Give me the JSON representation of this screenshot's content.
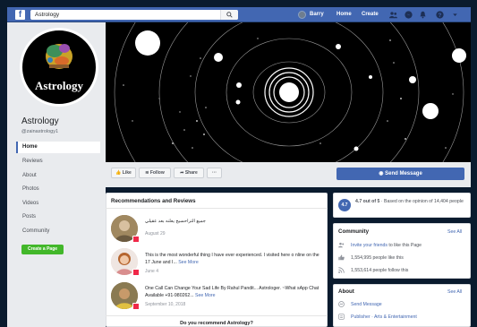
{
  "topbar": {
    "logo": "f",
    "search_value": "Astrology",
    "user_name": "Barry",
    "home": "Home",
    "create": "Create"
  },
  "sidebar": {
    "avatar_word": "Astrology",
    "page_name": "Astrology",
    "handle": "@zainastrology1",
    "items": [
      {
        "label": "Home"
      },
      {
        "label": "Reviews"
      },
      {
        "label": "About"
      },
      {
        "label": "Photos"
      },
      {
        "label": "Videos"
      },
      {
        "label": "Posts"
      },
      {
        "label": "Community"
      }
    ],
    "create_page": "Create a Page"
  },
  "actions": {
    "like": "Like",
    "follow": "Follow",
    "share": "Share",
    "more": "···",
    "send_message": "Send Message"
  },
  "recommendations": {
    "title": "Recommendations and Reviews",
    "reviews": [
      {
        "text": "جميع التراحسيح يعلنه بعد عقيلي",
        "date": "August 29",
        "see_more": ""
      },
      {
        "text": "This is the most wonderful thing I have ever experienced. I visited here o nline on the 17 June and I...",
        "date": "June 4",
        "see_more": "See More"
      },
      {
        "text": "One Call Can Change Your Sad Life By Rahul Pandit... Astrologer. ~What sApp Chat Available +91-980262...",
        "date": "September 10, 2018",
        "see_more": "See More"
      }
    ],
    "prompt": "Do you recommend Astrology?"
  },
  "rating": {
    "score": "4.7",
    "text_bold": "4.7 out of 5",
    "text_rest": " · Based on the opinion of 14,404 people"
  },
  "community": {
    "title": "Community",
    "see_all": "See All",
    "invite_link": "Invite your friends",
    "invite_rest": " to like this Page",
    "likes": "1,554,995 people like this",
    "follows": "1,553,614 people follow this"
  },
  "about": {
    "title": "About",
    "see_all": "See All",
    "send_message": "Send Message",
    "category_prefix": "Publisher",
    "category_rest": " · Arts & Entertainment"
  },
  "colors": {
    "brand": "#4267b2",
    "create_green": "#42b72a",
    "badge_red": "#f02849"
  }
}
